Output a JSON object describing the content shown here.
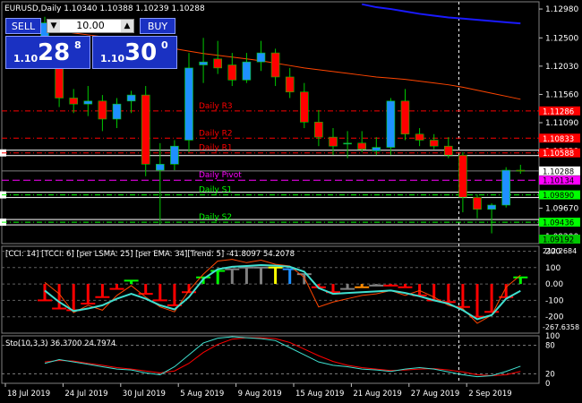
{
  "header": {
    "title": "EURUSD,Daily",
    "ohlc": "1.10340 1.10388 1.10239 1.10288"
  },
  "trade_panel": {
    "sell_label": "SELL",
    "buy_label": "BUY",
    "lot_value": "10.00",
    "sell_price": {
      "prefix": "1.10",
      "big": "28",
      "sup": "8"
    },
    "buy_price": {
      "prefix": "1.10",
      "big": "30",
      "sup": "0"
    }
  },
  "colors": {
    "bull": "#1e90ff",
    "bear": "#ff0000",
    "wick": "#00c800",
    "ema": "#ff4500",
    "ma": "#1a1aff",
    "ask": "#ff0000",
    "pivot": "#ff00ff",
    "resistance": "#ff0000",
    "support": "#00ff00",
    "current": "#ffffff",
    "cyan": "#40e0d0"
  },
  "pivots": [
    {
      "label": "Daily R3",
      "value": 1.11286,
      "tag": "1.11286",
      "color": "#ff0000",
      "dash": "6,3,1,3"
    },
    {
      "label": "Daily R2",
      "value": 1.10833,
      "tag": "1.10833",
      "color": "#ff0000",
      "dash": "6,3,1,3"
    },
    {
      "label": "Daily R1",
      "value": 1.10588,
      "tag": "1.10588",
      "color": "#ff0000",
      "dash": "6,3,1,3",
      "box": true
    },
    {
      "label": "Daily Pivot",
      "value": 1.10134,
      "tag": "1.10134",
      "color": "#ff00ff",
      "dash": "8,4"
    },
    {
      "label": "Daily S1",
      "value": 1.0989,
      "tag": "1.09890",
      "color": "#00ff00",
      "dash": "6,3,1,3",
      "box": true
    },
    {
      "label": "Daily S2",
      "value": 1.09436,
      "tag": "1.09436",
      "color": "#00ff00",
      "dash": "6,3,1,3",
      "box": true
    }
  ],
  "s3_tag": "1.09192",
  "current_price": {
    "value": 1.10288,
    "tag": "1.10288"
  },
  "ask_tag": "1.10134",
  "chart_data": [
    {
      "type": "candlestick",
      "price_axis_ticks": [
        "1.12980",
        "1.12500",
        "1.12030",
        "1.11560",
        "1.11090",
        "1.10620",
        "1.10150",
        "1.09670",
        "1.09200"
      ],
      "price_axis_values": [
        1.1298,
        1.125,
        1.1203,
        1.1156,
        1.1109,
        1.1062,
        1.1015,
        1.0967,
        1.092
      ],
      "ylim": [
        1.0908,
        1.131
      ],
      "x_labels": [
        "18 Jul 2019",
        "24 Jul 2019",
        "30 Jul 2019",
        "5 Aug 2019",
        "9 Aug 2019",
        "15 Aug 2019",
        "21 Aug 2019",
        "27 Aug 2019",
        "2 Sep 2019"
      ],
      "x_label_index": [
        0,
        4,
        8,
        12,
        16,
        20,
        24,
        28,
        32
      ],
      "candles": [
        {
          "o": 1.1225,
          "h": 1.1285,
          "l": 1.1208,
          "c": 1.1275
        },
        {
          "o": 1.1205,
          "h": 1.124,
          "l": 1.1135,
          "c": 1.115
        },
        {
          "o": 1.115,
          "h": 1.1165,
          "l": 1.1125,
          "c": 1.114
        },
        {
          "o": 1.114,
          "h": 1.117,
          "l": 1.112,
          "c": 1.1145
        },
        {
          "o": 1.1145,
          "h": 1.1155,
          "l": 1.1095,
          "c": 1.1115
        },
        {
          "o": 1.1115,
          "h": 1.115,
          "l": 1.11,
          "c": 1.114
        },
        {
          "o": 1.1145,
          "h": 1.1162,
          "l": 1.1125,
          "c": 1.1155
        },
        {
          "o": 1.1155,
          "h": 1.117,
          "l": 1.102,
          "c": 1.104
        },
        {
          "o": 1.103,
          "h": 1.1075,
          "l": 1.094,
          "c": 1.104
        },
        {
          "o": 1.104,
          "h": 1.108,
          "l": 1.103,
          "c": 1.107
        },
        {
          "o": 1.108,
          "h": 1.1225,
          "l": 1.106,
          "c": 1.12
        },
        {
          "o": 1.1205,
          "h": 1.125,
          "l": 1.1175,
          "c": 1.121
        },
        {
          "o": 1.1215,
          "h": 1.1245,
          "l": 1.119,
          "c": 1.12
        },
        {
          "o": 1.1205,
          "h": 1.1225,
          "l": 1.117,
          "c": 1.118
        },
        {
          "o": 1.118,
          "h": 1.1225,
          "l": 1.1175,
          "c": 1.121
        },
        {
          "o": 1.121,
          "h": 1.1245,
          "l": 1.1195,
          "c": 1.1225
        },
        {
          "o": 1.1225,
          "h": 1.1232,
          "l": 1.117,
          "c": 1.1185
        },
        {
          "o": 1.1185,
          "h": 1.12,
          "l": 1.115,
          "c": 1.116
        },
        {
          "o": 1.116,
          "h": 1.1175,
          "l": 1.11,
          "c": 1.111
        },
        {
          "o": 1.111,
          "h": 1.113,
          "l": 1.107,
          "c": 1.1085
        },
        {
          "o": 1.1085,
          "h": 1.11,
          "l": 1.1055,
          "c": 1.107
        },
        {
          "o": 1.1075,
          "h": 1.1095,
          "l": 1.105,
          "c": 1.1075
        },
        {
          "o": 1.1075,
          "h": 1.1095,
          "l": 1.106,
          "c": 1.1065
        },
        {
          "o": 1.1062,
          "h": 1.1085,
          "l": 1.1055,
          "c": 1.1068
        },
        {
          "o": 1.1068,
          "h": 1.115,
          "l": 1.1055,
          "c": 1.1145
        },
        {
          "o": 1.1145,
          "h": 1.1165,
          "l": 1.108,
          "c": 1.109
        },
        {
          "o": 1.109,
          "h": 1.11,
          "l": 1.107,
          "c": 1.108
        },
        {
          "o": 1.108,
          "h": 1.109,
          "l": 1.1065,
          "c": 1.107
        },
        {
          "o": 1.107,
          "h": 1.1085,
          "l": 1.105,
          "c": 1.1055
        },
        {
          "o": 1.1055,
          "h": 1.106,
          "l": 1.096,
          "c": 1.0985
        },
        {
          "o": 1.0985,
          "h": 1.099,
          "l": 1.095,
          "c": 1.0965
        },
        {
          "o": 1.0965,
          "h": 1.0975,
          "l": 1.0925,
          "c": 1.0972
        },
        {
          "o": 1.0972,
          "h": 1.1035,
          "l": 1.0968,
          "c": 1.103
        },
        {
          "o": 1.103,
          "h": 1.1039,
          "l": 1.1024,
          "c": 1.1029
        }
      ],
      "ema_series": [
        1.1265,
        1.1262,
        1.1258,
        1.1255,
        1.1252,
        1.1248,
        1.1244,
        1.124,
        1.1236,
        1.1232,
        1.1228,
        1.1224,
        1.1221,
        1.1218,
        1.1215,
        1.1212,
        1.1208,
        1.1204,
        1.12,
        1.1197,
        1.1194,
        1.1191,
        1.1188,
        1.1185,
        1.1183,
        1.1181,
        1.1178,
        1.1175,
        1.1172,
        1.1168,
        1.1163,
        1.1158,
        1.1153,
        1.1148
      ],
      "ma_series": [
        1.1402,
        1.14,
        1.1398,
        1.1396,
        1.1394,
        1.1392,
        1.139,
        1.1388,
        1.1385,
        1.1382,
        1.1379,
        1.1376,
        1.1372,
        1.1368,
        1.1362,
        1.1355,
        1.1348,
        1.134,
        1.1332,
        1.1325,
        1.1318,
        1.1312,
        1.1306,
        1.1301,
        1.1298,
        1.1294,
        1.129,
        1.1287,
        1.1284,
        1.1282,
        1.128,
        1.1278,
        1.1276,
        1.1274
      ]
    },
    {
      "type": "bar",
      "title": "[CCI: 14] [TCCI: 6] [per LSMA: 25] [per EMA: 34][Trend: 5] -41.8097 54.2078",
      "axis_ticks": [
        "200",
        "100",
        "0.00",
        "-100",
        "-200"
      ],
      "axis_values": [
        200,
        100,
        0,
        -100,
        -200
      ],
      "extra_tags": [
        "212.2684",
        "-267.6358"
      ],
      "ylim": [
        -300,
        230
      ],
      "histogram": [
        -100,
        -150,
        -160,
        -120,
        -80,
        -30,
        20,
        -60,
        -100,
        -130,
        -50,
        40,
        80,
        90,
        100,
        100,
        100,
        90,
        60,
        -20,
        -50,
        -30,
        -20,
        -10,
        -10,
        -20,
        -70,
        -100,
        -110,
        -140,
        -200,
        -170,
        -80,
        40
      ],
      "histogram_colors": [
        "#ff0000",
        "#ff0000",
        "#ff0000",
        "#ff0000",
        "#ff0000",
        "#ff0000",
        "#00ff00",
        "#ff0000",
        "#ff0000",
        "#ff0000",
        "#ff0000",
        "#00ff00",
        "#00ff00",
        "#808080",
        "#808080",
        "#808080",
        "#ffff00",
        "#1e90ff",
        "#808080",
        "#ff0000",
        "#ff0000",
        "#808080",
        "#ff8c00",
        "#808080",
        "#ff0000",
        "#ff0000",
        "#ff0000",
        "#ff0000",
        "#ff0000",
        "#ff0000",
        "#ff0000",
        "#ff0000",
        "#ff0000",
        "#00ff00"
      ],
      "cci_line": [
        -40,
        -110,
        -165,
        -150,
        -130,
        -90,
        -60,
        -90,
        -130,
        -155,
        -80,
        30,
        90,
        105,
        110,
        115,
        112,
        105,
        75,
        -25,
        -60,
        -55,
        -50,
        -45,
        -40,
        -55,
        -75,
        -100,
        -120,
        -160,
        -215,
        -190,
        -90,
        -42
      ],
      "tcci_line": [
        10,
        -60,
        -175,
        -130,
        -160,
        -70,
        -10,
        -80,
        -140,
        -170,
        -40,
        60,
        140,
        150,
        130,
        145,
        120,
        110,
        40,
        -140,
        -110,
        -90,
        -70,
        -60,
        -40,
        -70,
        -40,
        -80,
        -130,
        -150,
        -240,
        -190,
        -20,
        54
      ]
    },
    {
      "type": "line",
      "title": "Sto(10,3,3) 36.3700 24.7974",
      "axis_ticks": [
        "100",
        "80",
        "20",
        "0"
      ],
      "axis_values": [
        100,
        80,
        20,
        0
      ],
      "ylim": [
        0,
        100
      ],
      "main": [
        42,
        50,
        45,
        40,
        35,
        30,
        28,
        22,
        18,
        35,
        60,
        85,
        95,
        98,
        96,
        94,
        90,
        75,
        60,
        45,
        38,
        35,
        30,
        28,
        25,
        30,
        33,
        30,
        24,
        18,
        14,
        16,
        25,
        36
      ],
      "signal": [
        45,
        48,
        47,
        42,
        38,
        33,
        30,
        26,
        22,
        26,
        42,
        65,
        82,
        93,
        96,
        96,
        94,
        86,
        72,
        58,
        46,
        38,
        33,
        30,
        27,
        28,
        30,
        31,
        28,
        24,
        18,
        16,
        18,
        25
      ]
    }
  ]
}
